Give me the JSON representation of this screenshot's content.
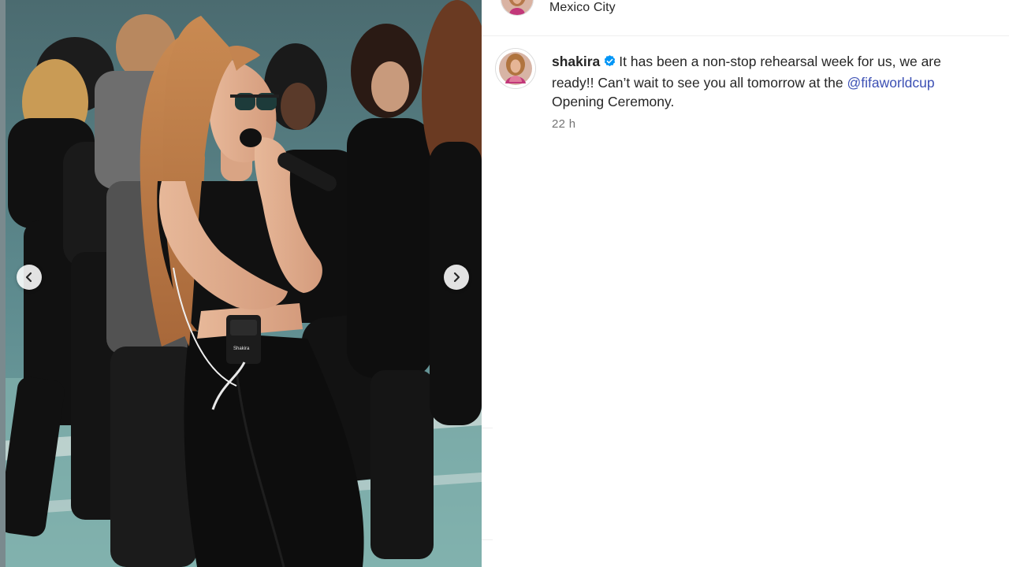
{
  "header": {
    "location": "Mexico City",
    "avatar_icon": "profile-avatar"
  },
  "media": {
    "description_icon": "photo-rehearsal",
    "prev_icon": "chevron-left-icon",
    "next_icon": "chevron-right-icon",
    "mic_brand": "Shakira"
  },
  "post": {
    "username": "shakira",
    "verified": true,
    "caption_before": "It has been a non-stop rehearsal week for us, we are ready!! Can’t wait to see you all tomorrow at the ",
    "mention": "@fifaworldcup",
    "caption_after": " Opening Ceremony.",
    "timestamp": "22 h"
  },
  "colors": {
    "text": "#262626",
    "muted": "#737373",
    "mention": "#3c50b4",
    "verified": "#0095f6",
    "border": "#dbdbdb"
  }
}
